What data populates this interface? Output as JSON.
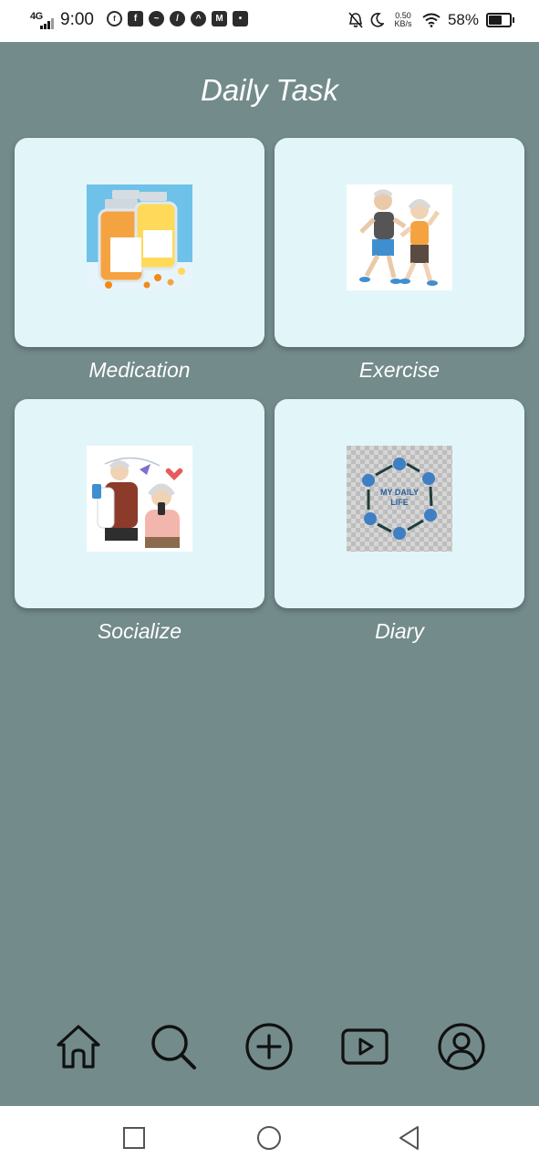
{
  "status_bar": {
    "network": "4G",
    "time": "9:00",
    "app_icons": [
      "facebook-icon",
      "facebook-square-icon",
      "messenger-icon",
      "leaf-icon",
      "a-icon",
      "gmail-icon",
      "mic-icon"
    ],
    "net_speed_value": "0.50",
    "net_speed_unit": "KB/s",
    "battery_percent_label": "58%",
    "battery_level": 0.58
  },
  "page": {
    "title": "Daily Task"
  },
  "cards": [
    {
      "label": "Medication",
      "icon": "medicine-bottles-image"
    },
    {
      "label": "Exercise",
      "icon": "elderly-couple-running-image"
    },
    {
      "label": "Socialize",
      "icon": "elderly-couple-phones-image"
    },
    {
      "label": "Diary",
      "icon": "my-daily-life-image",
      "image_text_line1": "MY DAILY",
      "image_text_line2": "LIFE"
    }
  ],
  "bottom_nav": [
    "home-icon",
    "search-icon",
    "add-icon",
    "video-icon",
    "profile-icon"
  ],
  "system_nav": [
    "recents-icon",
    "home-circle-icon",
    "back-icon"
  ],
  "colors": {
    "background": "#738b8b",
    "card": "#e2f6f9",
    "text": "#ffffff"
  }
}
